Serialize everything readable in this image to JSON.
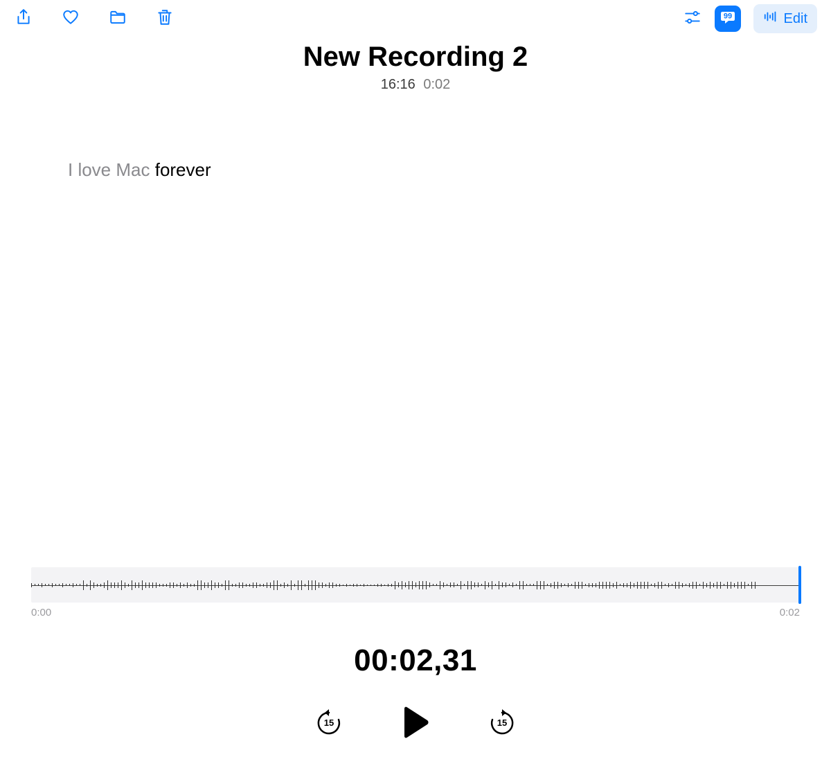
{
  "toolbar": {
    "edit_label": "Edit",
    "skip_seconds": "15"
  },
  "recording": {
    "title": "New Recording 2",
    "time_of_day": "16:16",
    "duration": "0:02"
  },
  "transcript": {
    "inactive_text": "I love Mac ",
    "active_text": "forever"
  },
  "waveform": {
    "start_label": "0:00",
    "end_label": "0:02"
  },
  "playback": {
    "current_time": "00:02,31",
    "skip_back": "15",
    "skip_forward": "15"
  }
}
